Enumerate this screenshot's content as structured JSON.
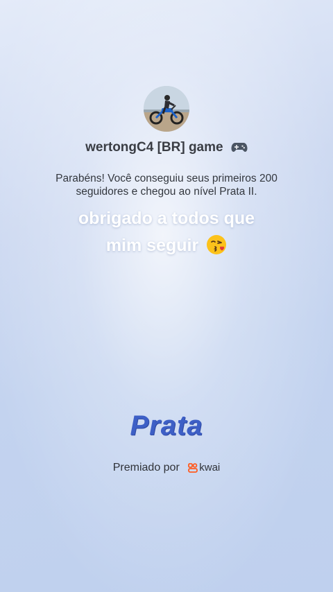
{
  "profile": {
    "username": "wertongC4 [BR] game",
    "avatar_icon": "motorcycle-rider-photo"
  },
  "achievement": {
    "message": "Parabéns! Você conseguiu seus primeiros 200 seguidores e chegou ao nível Prata II.",
    "caption_line1": "obrigado a todos que",
    "caption_line2": "mim seguir",
    "level_name": "Prata"
  },
  "footer": {
    "awarded_by": "Premiado por",
    "brand": "kwai",
    "brand_color": "#ff5a1f"
  },
  "colors": {
    "level_text": "#3d5fc6",
    "background": "#c3d3ef"
  }
}
